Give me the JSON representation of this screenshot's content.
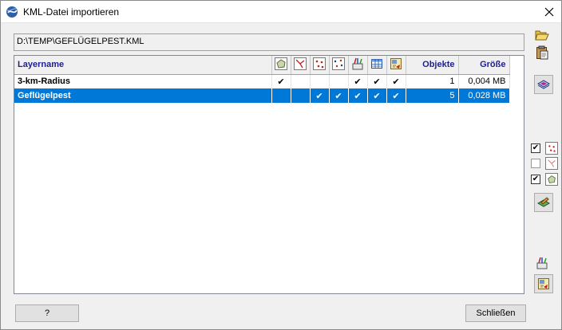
{
  "window": {
    "title": "KML-Datei importieren"
  },
  "path_field": {
    "value": "D:\\TEMP\\GEFLÜGELPEST.KML"
  },
  "table": {
    "columns": {
      "layername": "Layername",
      "objekte": "Objekte",
      "groesse": "Größe"
    },
    "icon_columns": [
      "polygon-icon",
      "line-icon",
      "points-icon",
      "labels-icon",
      "style-brush-icon",
      "attribute-table-icon",
      "import-icon"
    ],
    "rows": [
      {
        "name": "3-km-Radius",
        "checks": [
          "✔",
          "",
          "",
          "",
          "✔",
          "✔",
          "✔"
        ],
        "objekte": "1",
        "groesse": "0,004 MB",
        "selected": false
      },
      {
        "name": "Geflügelpest",
        "checks": [
          "",
          "",
          "✔",
          "✔",
          "✔",
          "✔",
          "✔"
        ],
        "objekte": "5",
        "groesse": "0,028 MB",
        "selected": true
      }
    ]
  },
  "filters": [
    {
      "checked": true,
      "icon": "points-icon"
    },
    {
      "checked": false,
      "icon": "line-icon"
    },
    {
      "checked": true,
      "icon": "polygon-icon"
    }
  ],
  "buttons": {
    "help_label": "?",
    "close_label": "Schließen"
  },
  "colors": {
    "selection": "#0078d7",
    "header_text": "#1f1f8f"
  }
}
